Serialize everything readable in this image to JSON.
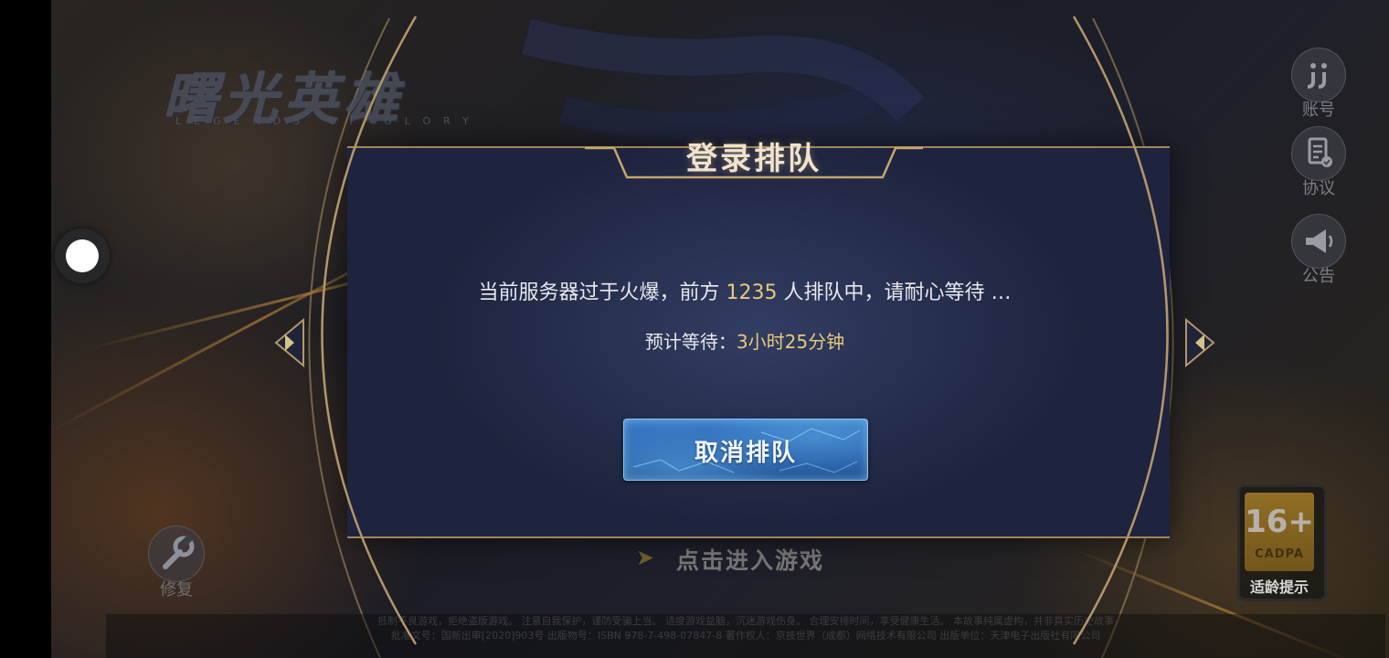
{
  "game": {
    "title": "曙光英雄",
    "subtitle": "LEGENDS OF GLORY"
  },
  "side_menu": {
    "account_label": "账号",
    "agreement_label": "协议",
    "notice_label": "公告"
  },
  "repair_label": "修复",
  "age_rating": {
    "number": "16+",
    "org": "CADPA",
    "label": "适龄提示"
  },
  "enter_game_label": "点击进入游戏",
  "queue_dialog": {
    "title": "登录排队",
    "message_prefix": "当前服务器过于火爆，前方",
    "queue_count": "1235",
    "message_suffix": "人排队中，请耐心等待 …",
    "wait_label": "预计等待：",
    "wait_time": "3小时25分钟",
    "cancel_button": "取消排队"
  },
  "copyright": {
    "line1": "抵制不良游戏，拒绝盗版游戏。 注意自我保护，谨防受骗上当。 适度游戏益脑，沉迷游戏伤身。 合理安排时间，享受健康生活。 本故事纯属虚构，并非真实历史故事",
    "line2": "批准文号：国新出审[2020]903号 出版物号：ISBN 978-7-498-07847-8 著作权人：京技世界（成都）网络技术有限公司 出版单位：天津电子出版社有限公司"
  },
  "colors": {
    "accent_gold": "#e8c87a",
    "frame_gold": "#a0865a",
    "button_blue": "#2a64ad"
  }
}
